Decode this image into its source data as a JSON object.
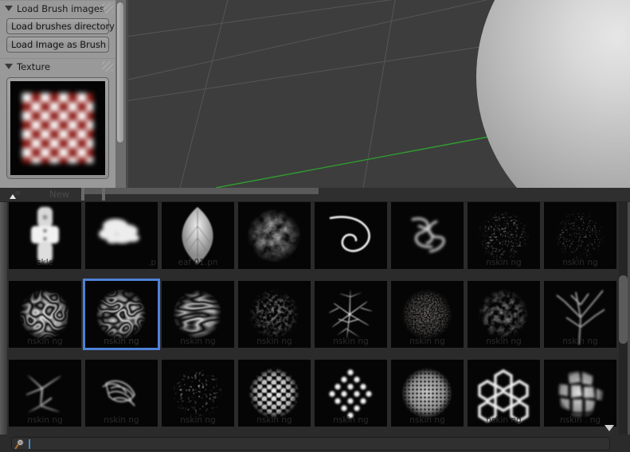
{
  "sidebar": {
    "panels": [
      {
        "title": "Load Brush images",
        "collapsed": false
      },
      {
        "title": "Texture",
        "collapsed": false
      }
    ],
    "buttons": [
      {
        "label": "Load brushes directory"
      },
      {
        "label": "Load Image as Brush"
      }
    ],
    "texture_preview": {
      "name": "checker-texture-preview",
      "pattern": "blurred-red-white-checkerboard",
      "colors": {
        "square": "#8b1a15",
        "background": "#fdfdfd",
        "border": "#040404"
      }
    },
    "scrollbar": {
      "name": "sidebar-scrollbar",
      "position_percent": 0
    }
  },
  "viewport": {
    "name": "3d-viewport",
    "background_color": "#3d3d3d",
    "grid_color": "#565656",
    "axis_y_color": "#2f9c2f",
    "object": "sphere"
  },
  "browser": {
    "header": {
      "icon": "image-icon",
      "label": "New"
    },
    "background_color": "#2b2b2b",
    "selection_color": "#4f81d6",
    "thumbnails": [
      [
        {
          "label": "ckle",
          "art": "spray-can"
        },
        {
          "label": ".p",
          "art": "cloud"
        },
        {
          "label": "eaf 01.pn",
          "art": "leaf"
        },
        {
          "label": "",
          "art": "burst"
        },
        {
          "label": "",
          "art": "swirl"
        },
        {
          "label": "",
          "art": "smoke"
        },
        {
          "label": "nskin     ng",
          "art": "speckle"
        },
        {
          "label": "nskin     ng",
          "art": "speckle2"
        }
      ],
      [
        {
          "label": "nskin     ng",
          "art": "maze"
        },
        {
          "label": "nskin     ng",
          "art": "maze2",
          "selected": true
        },
        {
          "label": "nskin     ng",
          "art": "ripples"
        },
        {
          "label": "nskin     ng",
          "art": "fibers"
        },
        {
          "label": "nskin     ng",
          "art": "veins"
        },
        {
          "label": "nskin     ng",
          "art": "grain"
        },
        {
          "label": "nskin     ng",
          "art": "bumpy"
        },
        {
          "label": "nskin     ng",
          "art": "branches"
        }
      ],
      [
        {
          "label": "nskin     ng",
          "art": "cracks"
        },
        {
          "label": "nskin     ng",
          "art": "feathers"
        },
        {
          "label": "nskin     ng",
          "art": "pebbles"
        },
        {
          "label": "nskin     ng",
          "art": "honeycomb"
        },
        {
          "label": "nskin     ng",
          "art": "dots-diamond"
        },
        {
          "label": "nskin     ng",
          "art": "fine-dots"
        },
        {
          "label": "nskin     ng",
          "art": "hex-outline"
        },
        {
          "label": "nskin  .  ng",
          "art": "voronoi"
        }
      ]
    ],
    "scrollbar": {
      "name": "browser-scrollbar"
    },
    "expand_arrow": {
      "name": "expand-down-arrow"
    }
  },
  "search": {
    "icon": "magnifier-icon",
    "value": "",
    "placeholder": ""
  }
}
